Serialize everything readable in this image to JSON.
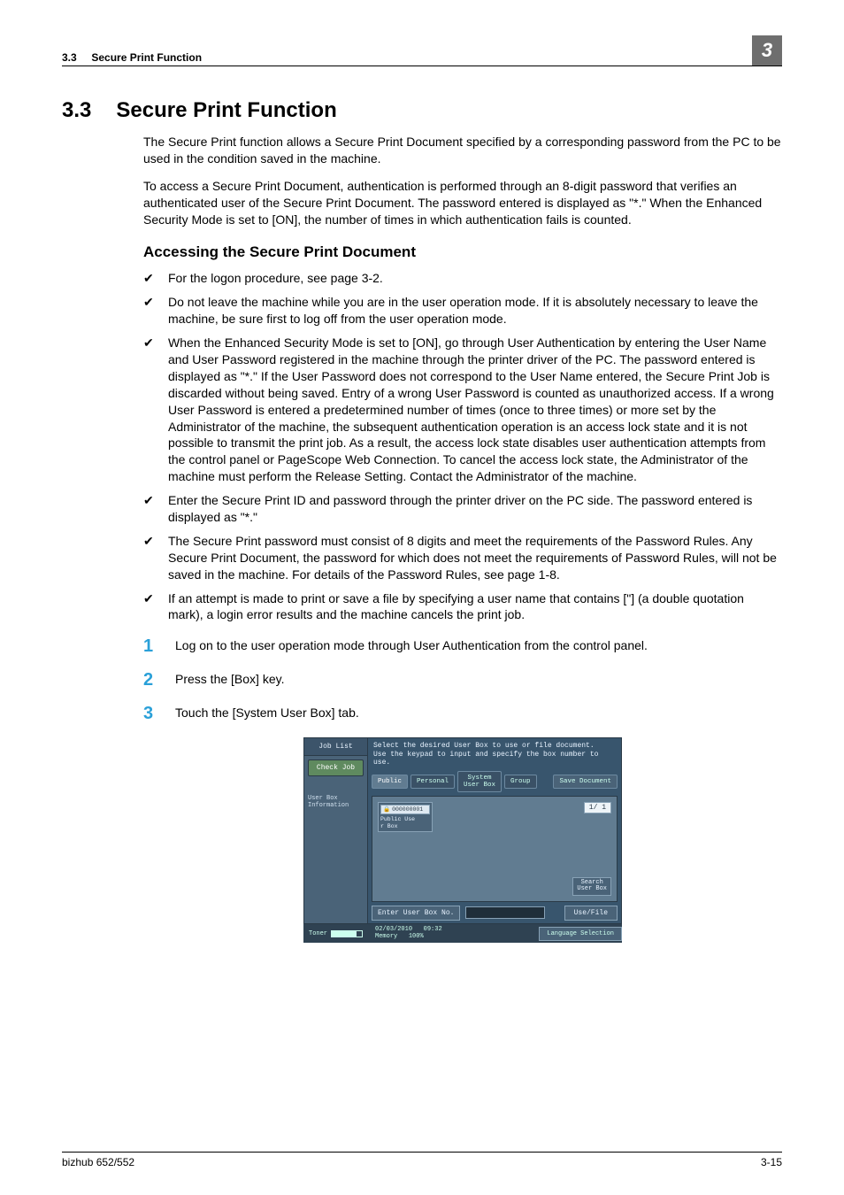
{
  "header": {
    "section_no": "3.3",
    "section_title": "Secure Print Function",
    "chapter_no": "3"
  },
  "title": {
    "number": "3.3",
    "text": "Secure Print Function"
  },
  "paragraphs": {
    "p1": "The Secure Print function allows a Secure Print Document specified by a corresponding password from the PC to be used in the condition saved in the machine.",
    "p2": "To access a Secure Print Document, authentication is performed through an 8-digit password that verifies an authenticated user of the Secure Print Document. The password entered is displayed as \"*.\" When the Enhanced Security Mode is set to [ON], the number of times in which authentication fails is counted."
  },
  "subhead": "Accessing the Secure Print Document",
  "bullets": [
    "For the logon procedure, see page 3-2.",
    "Do not leave the machine while you are in the user operation mode. If it is absolutely necessary to leave the machine, be sure first to log off from the user operation mode.",
    "When the Enhanced Security Mode is set to [ON], go through User Authentication by entering the User Name and User Password registered in the machine through the printer driver of the PC. The password entered is displayed as \"*.\" If the User Password does not correspond to the User Name entered, the Secure Print Job is discarded without being saved. Entry of a wrong User Password is counted as unauthorized access. If a wrong User Password is entered a predetermined number of times (once to three times) or more set by the Administrator of the machine, the subsequent authentication operation is an access lock state and it is not possible to transmit the print job. As a result, the access lock state disables user authentication attempts from the control panel or PageScope Web Connection. To cancel the access lock state, the Administrator of the machine must perform the Release Setting. Contact the Administrator of the machine.",
    "Enter the Secure Print ID and password through the printer driver on the PC side. The password entered is displayed as \"*.\"",
    "The Secure Print password must consist of 8 digits and meet the requirements of the Password Rules. Any Secure Print Document, the password for which does not meet the requirements of Password Rules, will not be saved in the machine. For details of the Password Rules, see page 1-8.",
    "If an attempt is made to print or save a file by specifying a user name that contains [\"] (a double quotation mark), a login error results and the machine cancels the print job."
  ],
  "steps": [
    "Log on to the user operation mode through User Authentication from the control panel.",
    "Press the [Box] key.",
    "Touch the [System User Box] tab."
  ],
  "screen": {
    "sidebar": {
      "joblist": "Job List",
      "checkjob": "Check Job",
      "info": "User Box\nInformation"
    },
    "instruction": "Select the desired User Box to use or file document.\nUse the keypad to input and specify the box number to use.",
    "tabs": {
      "public": "Public",
      "personal": "Personal",
      "system": "System\nUser Box",
      "group": "Group",
      "save": "Save Document"
    },
    "box": {
      "number": "000000001",
      "name": "Public Use\nr Box"
    },
    "page_indicator": "1/  1",
    "search": "Search\nUser Box",
    "enter_label": "Enter User Box No.",
    "usefile": "Use/File",
    "status": {
      "toner": "Toner",
      "date": "02/03/2010",
      "time": "09:32",
      "memory_label": "Memory",
      "memory_val": "100%",
      "lang": "Language Selection"
    }
  },
  "footer": {
    "left": "bizhub 652/552",
    "right": "3-15"
  }
}
